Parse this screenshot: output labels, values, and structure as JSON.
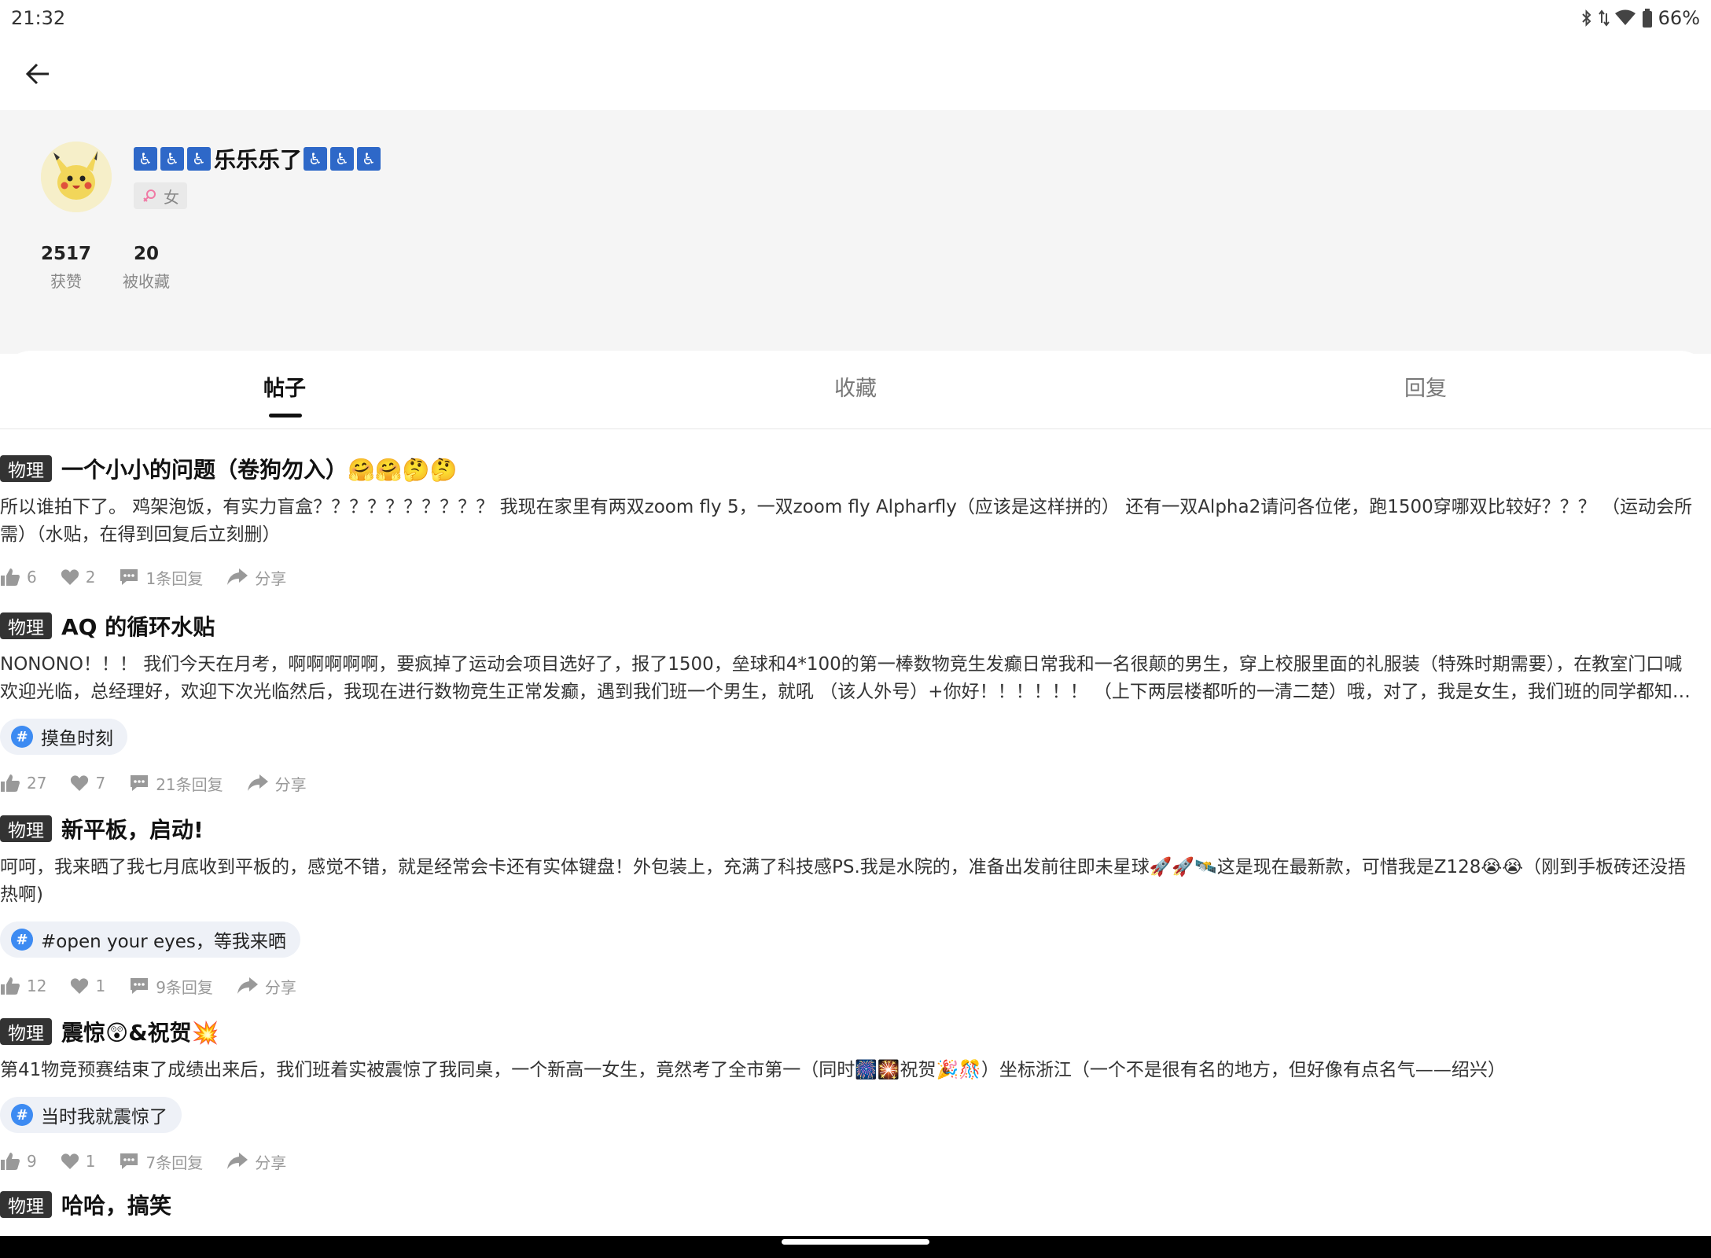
{
  "status": {
    "time": "21:32",
    "battery": "66%"
  },
  "profile": {
    "username_prefix_icons": 3,
    "username": "乐乐乐了",
    "username_suffix_icons": 3,
    "gender": "女",
    "stats": [
      {
        "value": "2517",
        "label": "获赞"
      },
      {
        "value": "20",
        "label": "被收藏"
      }
    ]
  },
  "tabs": [
    {
      "label": "帖子",
      "active": true
    },
    {
      "label": "收藏",
      "active": false
    },
    {
      "label": "回复",
      "active": false
    }
  ],
  "posts": [
    {
      "tag": "物理",
      "title": "一个小小的问题（卷狗勿入）🤗🤗🤔🤔",
      "body": "所以谁拍下了。 鸡架泡饭，有实力盲盒？？？？？？？？？？ 我现在家里有两双zoom fly 5，一双zoom fly Alpharfly（应该是这样拼的）                 还有一双Alpha2请问各位佬，跑1500穿哪双比较好？？？ （运动会所需）（水贴，在得到回复后立刻删）",
      "topic": "",
      "likes": "6",
      "favorites": "2",
      "replies": "1条回复",
      "share": "分享"
    },
    {
      "tag": "物理",
      "title": "AQ 的循环水贴",
      "body": "NONONO！！！ 我们今天在月考，啊啊啊啊啊，要疯掉了运动会项目选好了，报了1500，垒球和4*100的第一棒数物竞生发癫日常我和一名很颠的男生，穿上校服里面的礼服装（特殊时期需要），在教室门口喊欢迎光临，总经理好，欢迎下次光临然后，我现在进行数物竞生正常发癫，遇到我们班一个男生，就吼  （该人外号）+你好！！！！！！ （上下两层楼都听的一清二楚）哦，对了，我是女生，我们班的同学都知道我的发癫日常",
      "topic": "摸鱼时刻",
      "likes": "27",
      "favorites": "7",
      "replies": "21条回复",
      "share": "分享"
    },
    {
      "tag": "物理",
      "title": "新平板，启动!",
      "body": "呵呵，我来晒了我七月底收到平板的，感觉不错，就是经常会卡还有实体键盘！外包装上，充满了科技感PS.我是水院的，准备出发前往即未星球🚀🚀🛰️这是现在最新款，可惜我是Z128😭😭（刚到手板砖还没捂热啊)",
      "topic": "#open your eyes，等我来晒",
      "likes": "12",
      "favorites": "1",
      "replies": "9条回复",
      "share": "分享"
    },
    {
      "tag": "物理",
      "title": "震惊😲&祝贺💥",
      "body": "第41物竞预赛结束了成绩出来后，我们班着实被震惊了我同桌，一个新高一女生，竟然考了全市第一（同时🎆🎇祝贺🎉🎊）坐标浙江（一个不是很有名的地方，但好像有点名气——绍兴）",
      "topic": "当时我就震惊了",
      "likes": "9",
      "favorites": "1",
      "replies": "7条回复",
      "share": "分享"
    },
    {
      "tag": "物理",
      "title": "哈哈，搞笑",
      "body": "",
      "topic": "",
      "likes": "",
      "favorites": "",
      "replies": "",
      "share": ""
    }
  ],
  "colors": {
    "accent": "#3d8bf2",
    "tag_bg": "#333333",
    "profile_bg": "#f5f5f5"
  }
}
